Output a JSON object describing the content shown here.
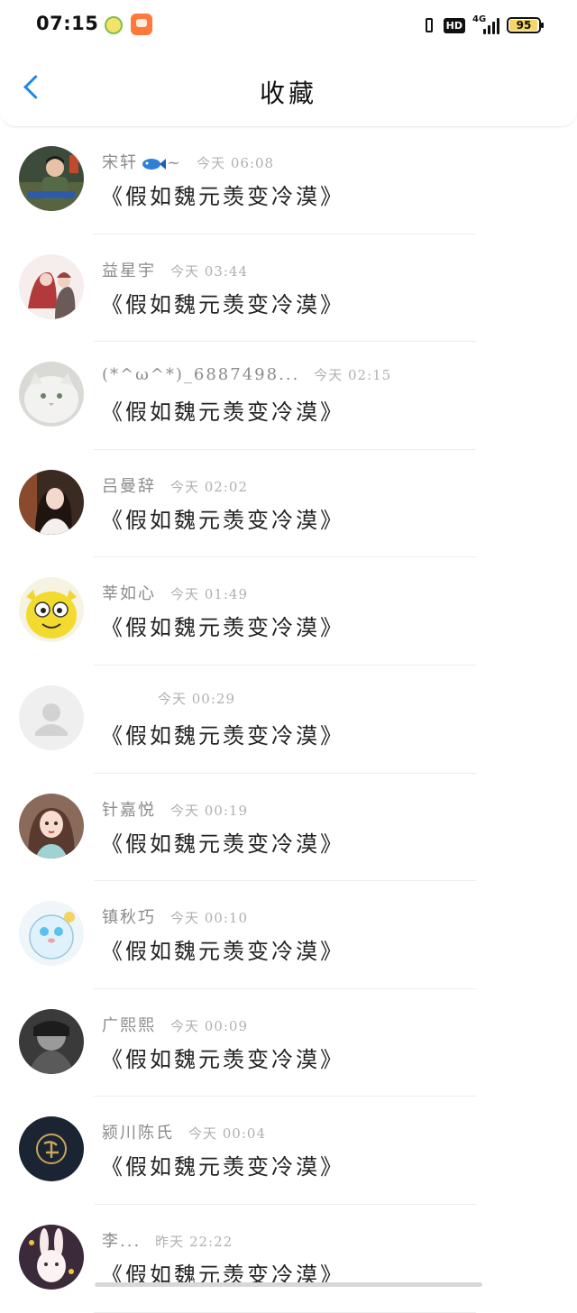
{
  "status_bar": {
    "time": "07:15",
    "network": "4G",
    "hd": "HD",
    "battery": "95",
    "battery_level": 0.95,
    "battery_color": "#f5d56a",
    "icons": [
      "weather-app-icon",
      "shopping-app-icon",
      "vibrate-icon",
      "hd-icon",
      "signal-icon",
      "battery-icon"
    ]
  },
  "header": {
    "title": "收藏",
    "back_icon": "chevron-left-icon",
    "accent": "#1e88e5"
  },
  "items": [
    {
      "name": "宋轩",
      "name_suffix": "~",
      "time": "今天 06:08",
      "content": "《假如魏元羡变冷漠》",
      "avatar": "boy-photo"
    },
    {
      "name": "益星宇",
      "time": "今天 03:44",
      "content": "《假如魏元羡变冷漠》",
      "avatar": "couple-illustration"
    },
    {
      "name": "(*^ω^*)_6887498...",
      "time": "今天 02:15",
      "content": "《假如魏元羡变冷漠》",
      "avatar": "white-cat-photo"
    },
    {
      "name": "吕曼辞",
      "time": "今天 02:02",
      "content": "《假如魏元羡变冷漠》",
      "avatar": "girl-photo"
    },
    {
      "name": "莘如心",
      "time": "今天 01:49",
      "content": "《假如魏元羡变冷漠》",
      "avatar": "yellow-cartoon"
    },
    {
      "name": "",
      "time": "今天 00:29",
      "content": "《假如魏元羡变冷漠》",
      "avatar": "default-avatar"
    },
    {
      "name": "针嘉悦",
      "time": "今天 00:19",
      "content": "《假如魏元羡变冷漠》",
      "avatar": "anime-girl"
    },
    {
      "name": "镇秋巧",
      "time": "今天 00:10",
      "content": "《假如魏元羡变冷漠》",
      "avatar": "blue-cartoon"
    },
    {
      "name": "广熙熙",
      "time": "今天 00:09",
      "content": "《假如魏元羡变冷漠》",
      "avatar": "grayscale-photo"
    },
    {
      "name": "颍川陈氏",
      "time": "今天 00:04",
      "content": "《假如魏元羡变冷漠》",
      "avatar": "dark-calligraphy"
    },
    {
      "name": "李...",
      "time": "昨天 22:22",
      "content": "《假如魏元羡变冷漠》",
      "avatar": "bunny-illustration"
    }
  ]
}
